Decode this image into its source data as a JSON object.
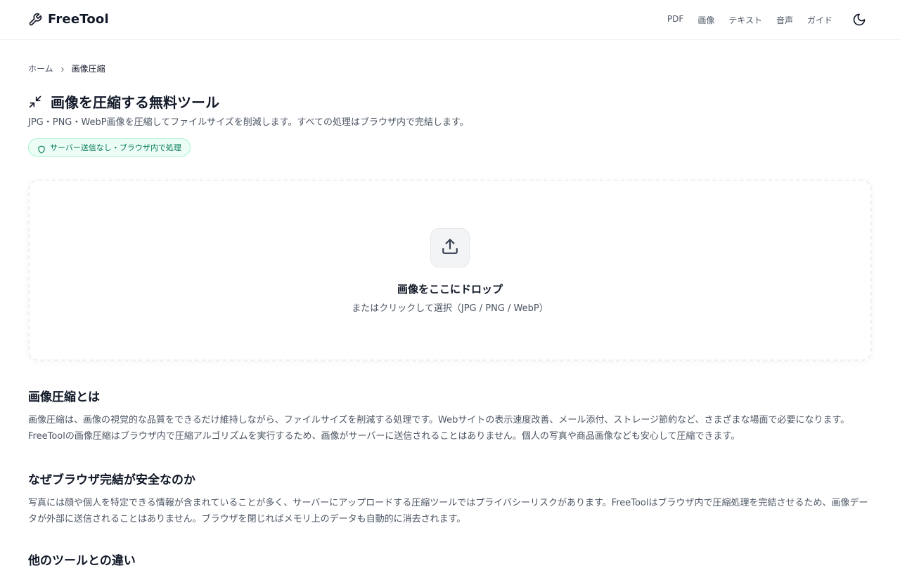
{
  "header": {
    "brand": "FreeTool",
    "nav": [
      "PDF",
      "画像",
      "テキスト",
      "音声",
      "ガイド"
    ]
  },
  "breadcrumb": {
    "home": "ホーム",
    "current": "画像圧縮"
  },
  "page": {
    "title": "画像を圧縮する無料ツール",
    "subtitle": "JPG・PNG・WebP画像を圧縮してファイルサイズを削減します。すべての処理はブラウザ内で完結します。",
    "badge": "サーバー送信なし・ブラウザ内で処理"
  },
  "dropzone": {
    "title": "画像をここにドロップ",
    "subtitle": "またはクリックして選択（JPG / PNG / WebP）"
  },
  "sections": [
    {
      "title": "画像圧縮とは",
      "body": "画像圧縮は、画像の視覚的な品質をできるだけ維持しながら、ファイルサイズを削減する処理です。Webサイトの表示速度改善、メール添付、ストレージ節約など、さまざまな場面で必要になります。FreeToolの画像圧縮はブラウザ内で圧縮アルゴリズムを実行するため、画像がサーバーに送信されることはありません。個人の写真や商品画像なども安心して圧縮できます。"
    },
    {
      "title": "なぜブラウザ完結が安全なのか",
      "body": "写真には顔や個人を特定できる情報が含まれていることが多く、サーバーにアップロードする圧縮ツールではプライバシーリスクがあります。FreeToolはブラウザ内で圧縮処理を完結させるため、画像データが外部に送信されることはありません。ブラウザを閉じればメモリ上のデータも自動的に消去されます。"
    },
    {
      "title": "他のツールとの違い"
    }
  ],
  "colors": {
    "accent_green": "#047857",
    "badge_bg": "#ecfdf5",
    "badge_border": "#a7f3d0",
    "text_primary": "#111827",
    "text_secondary": "#4b5563"
  },
  "icons": {
    "brand": "wrench-icon",
    "theme": "moon-icon",
    "breadcrumb_sep": "chevron-right-icon",
    "title": "minimize-arrows-icon",
    "badge": "shield-icon",
    "upload": "upload-icon"
  }
}
